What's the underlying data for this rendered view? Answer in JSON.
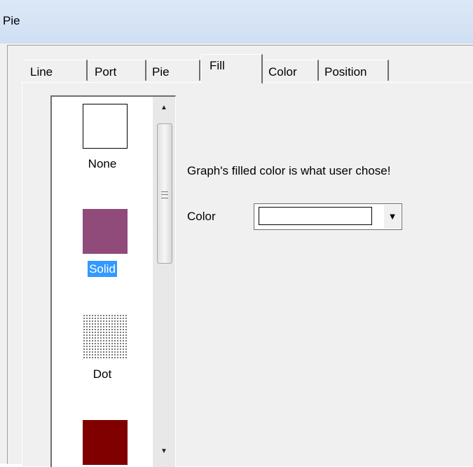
{
  "window": {
    "title": "Pie"
  },
  "tabs": [
    {
      "label": "Line"
    },
    {
      "label": "Port"
    },
    {
      "label": "Pie"
    },
    {
      "label": "Fill",
      "active": true
    },
    {
      "label": "Color"
    },
    {
      "label": "Position"
    }
  ],
  "fill_panel": {
    "patterns": [
      {
        "label": "None",
        "icon": "empty-swatch"
      },
      {
        "label": "Solid",
        "icon": "solid-swatch",
        "selected": true,
        "color": "#904b7a"
      },
      {
        "label": "Dot",
        "icon": "dot-pattern-swatch"
      },
      {
        "label": "",
        "icon": "dark-red-swatch",
        "color": "#800000"
      }
    ],
    "description": "Graph's filled color is what user chose!",
    "color_label": "Color",
    "color_value": "#ffffff"
  },
  "colors": {
    "selection": "#3399ff",
    "titlebar": "#dce8f7"
  }
}
